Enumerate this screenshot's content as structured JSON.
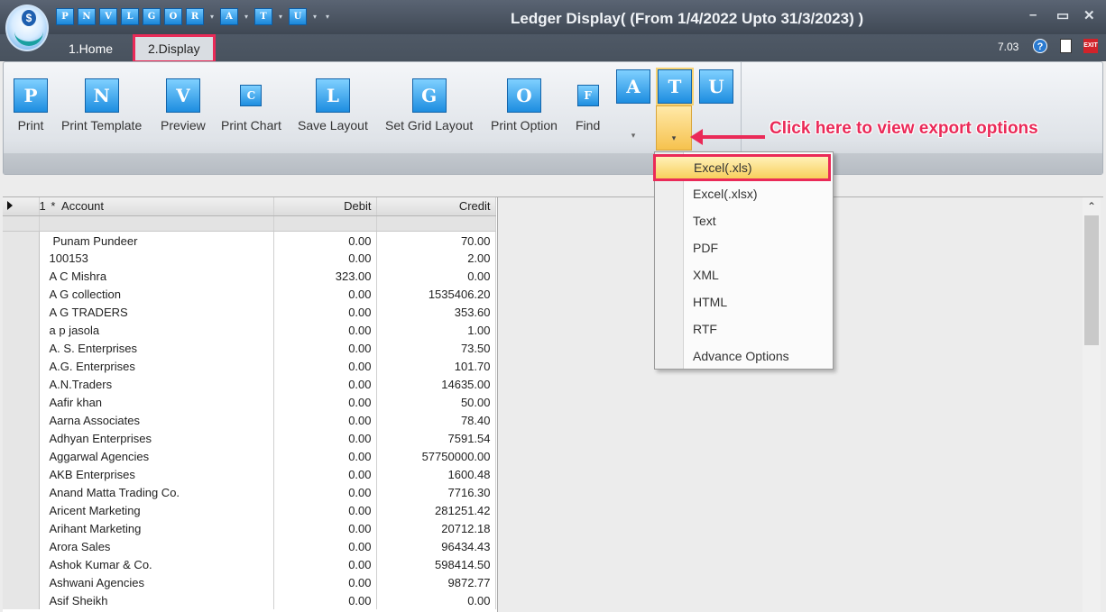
{
  "window": {
    "title": "Ledger Display( (From 1/4/2022 Upto 31/3/2023) )",
    "min_glyph": "–",
    "max_glyph": "▭",
    "close_glyph": "✕"
  },
  "logo": {
    "glyph": "$"
  },
  "quick_access": [
    "P",
    "N",
    "V",
    "L",
    "G",
    "O",
    "R",
    "A",
    "T",
    "U"
  ],
  "tabs": [
    {
      "label": "1.Home"
    },
    {
      "label": "2.Display"
    }
  ],
  "status": {
    "version": "7.03",
    "help_glyph": "?",
    "exit_glyph": "EXIT"
  },
  "ribbon": {
    "buttons": [
      {
        "label": "Print",
        "glyph": "P"
      },
      {
        "label": "Print Template",
        "glyph": "N"
      },
      {
        "label": "Preview",
        "glyph": "V"
      },
      {
        "label": "Print Chart",
        "glyph": "C"
      },
      {
        "label": "Save Layout",
        "glyph": "L"
      },
      {
        "label": "Set Grid Layout",
        "glyph": "G"
      },
      {
        "label": "Print Option",
        "glyph": "O"
      },
      {
        "label": "Find",
        "glyph": "F"
      }
    ],
    "export_buttons": [
      {
        "glyph": "A"
      },
      {
        "glyph": "T"
      },
      {
        "glyph": "U"
      }
    ],
    "dropdown_glyph": "▾"
  },
  "annotation": {
    "text": "Click here to view export options"
  },
  "export_menu": {
    "items": [
      "Excel(.xls)",
      "Excel(.xlsx)",
      "Text",
      "PDF",
      "XML",
      "HTML",
      "RTF",
      "Advance Options"
    ],
    "selected_index": 0
  },
  "grid": {
    "header": {
      "row_num": "1",
      "star": "*",
      "account": "Account",
      "debit": "Debit",
      "credit": "Credit"
    },
    "rows": [
      {
        "account": "Punam Pundeer",
        "debit": "0.00",
        "credit": "70.00"
      },
      {
        "account": "100153",
        "debit": "0.00",
        "credit": "2.00"
      },
      {
        "account": "A C Mishra",
        "debit": "323.00",
        "credit": "0.00"
      },
      {
        "account": "A G collection",
        "debit": "0.00",
        "credit": "1535406.20"
      },
      {
        "account": "A G TRADERS",
        "debit": "0.00",
        "credit": "353.60"
      },
      {
        "account": "a p jasola",
        "debit": "0.00",
        "credit": "1.00"
      },
      {
        "account": "A. S. Enterprises",
        "debit": "0.00",
        "credit": "73.50"
      },
      {
        "account": "A.G. Enterprises",
        "debit": "0.00",
        "credit": "101.70"
      },
      {
        "account": "A.N.Traders",
        "debit": "0.00",
        "credit": "14635.00"
      },
      {
        "account": "Aafir khan",
        "debit": "0.00",
        "credit": "50.00"
      },
      {
        "account": "Aarna Associates",
        "debit": "0.00",
        "credit": "78.40"
      },
      {
        "account": "Adhyan Enterprises",
        "debit": "0.00",
        "credit": "7591.54"
      },
      {
        "account": "Aggarwal Agencies",
        "debit": "0.00",
        "credit": "57750000.00"
      },
      {
        "account": "AKB Enterprises",
        "debit": "0.00",
        "credit": "1600.48"
      },
      {
        "account": "Anand Matta Trading Co.",
        "debit": "0.00",
        "credit": "7716.30"
      },
      {
        "account": "Aricent Marketing",
        "debit": "0.00",
        "credit": "281251.42"
      },
      {
        "account": "Arihant Marketing",
        "debit": "0.00",
        "credit": "20712.18"
      },
      {
        "account": "Arora Sales",
        "debit": "0.00",
        "credit": "96434.43"
      },
      {
        "account": "Ashok Kumar & Co.",
        "debit": "0.00",
        "credit": "598414.50"
      },
      {
        "account": "Ashwani Agencies",
        "debit": "0.00",
        "credit": "9872.77"
      },
      {
        "account": "Asif Sheikh",
        "debit": "0.00",
        "credit": "0.00"
      }
    ]
  },
  "scrollbar": {
    "up_glyph": "⌃"
  }
}
